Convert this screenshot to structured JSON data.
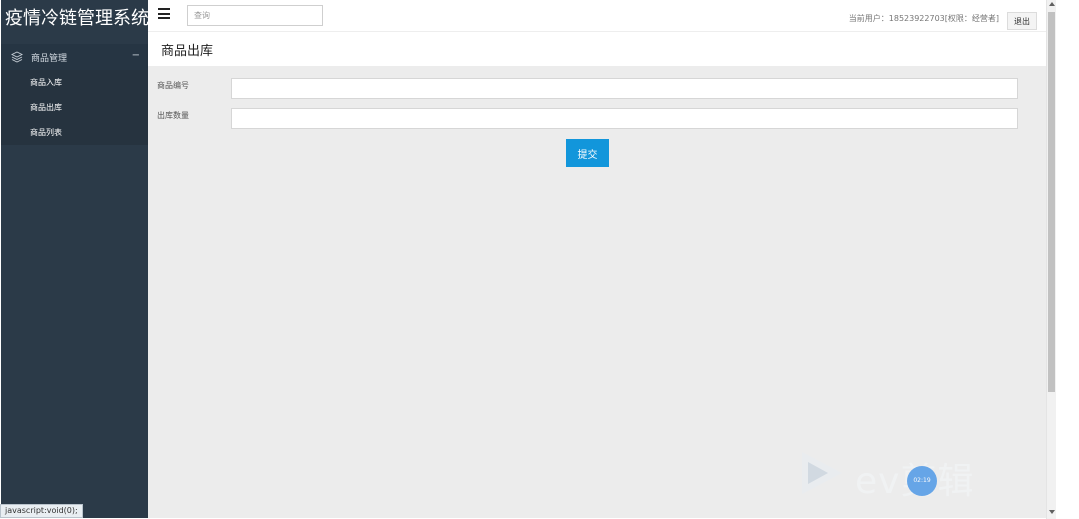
{
  "sidebar": {
    "brand": "疫情冷链管理系统",
    "group": {
      "label": "商品管理",
      "icon": "layers-icon",
      "collapse_symbol": "−"
    },
    "items": [
      {
        "label": "商品入库"
      },
      {
        "label": "商品出库"
      },
      {
        "label": "商品列表"
      }
    ]
  },
  "topbar": {
    "menu_icon": "hamburger-menu-icon",
    "search_placeholder": "查询",
    "user_info": "当前用户：18523922703[权限：经营者]",
    "logout_label": "退出"
  },
  "page": {
    "title": "商品出库"
  },
  "form": {
    "fields": [
      {
        "label": "商品编号",
        "value": ""
      },
      {
        "label": "出库数量",
        "value": ""
      }
    ],
    "submit_label": "提交"
  },
  "status_bar": {
    "text": "javascript:void(0);"
  },
  "watermark": {
    "text": "ev剪辑",
    "badge": "02:19"
  },
  "colors": {
    "sidebar_bg": "#2b3a48",
    "content_bg": "#ececec",
    "accent": "#1296db"
  }
}
